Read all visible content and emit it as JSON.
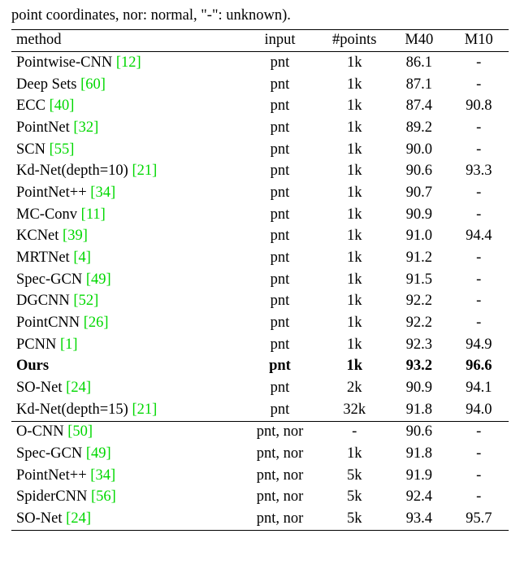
{
  "caption": "point coordinates, nor: normal, \"-\": unknown).",
  "headers": {
    "method": "method",
    "input": "input",
    "points": "#points",
    "m40": "M40",
    "m10": "M10"
  },
  "rows": [
    {
      "name": "Pointwise-CNN ",
      "cite": "[12]",
      "input": "pnt",
      "points": "1k",
      "m40": "86.1",
      "m10": "-",
      "group": 0
    },
    {
      "name": "Deep Sets ",
      "cite": "[60]",
      "input": "pnt",
      "points": "1k",
      "m40": "87.1",
      "m10": "-",
      "group": 0
    },
    {
      "name": "ECC ",
      "cite": "[40]",
      "input": "pnt",
      "points": "1k",
      "m40": "87.4",
      "m10": "90.8",
      "group": 0
    },
    {
      "name": "PointNet ",
      "cite": "[32]",
      "input": "pnt",
      "points": "1k",
      "m40": "89.2",
      "m10": "-",
      "group": 0
    },
    {
      "name": "SCN ",
      "cite": "[55]",
      "input": "pnt",
      "points": "1k",
      "m40": "90.0",
      "m10": "-",
      "group": 0
    },
    {
      "name": "Kd-Net(depth=10) ",
      "cite": "[21]",
      "input": "pnt",
      "points": "1k",
      "m40": "90.6",
      "m10": "93.3",
      "group": 0
    },
    {
      "name": "PointNet++ ",
      "cite": "[34]",
      "input": "pnt",
      "points": "1k",
      "m40": "90.7",
      "m10": "-",
      "group": 0
    },
    {
      "name": "MC-Conv ",
      "cite": "[11]",
      "input": "pnt",
      "points": "1k",
      "m40": "90.9",
      "m10": "-",
      "group": 0
    },
    {
      "name": "KCNet ",
      "cite": "[39]",
      "input": "pnt",
      "points": "1k",
      "m40": "91.0",
      "m10": "94.4",
      "group": 0
    },
    {
      "name": "MRTNet ",
      "cite": "[4]",
      "input": "pnt",
      "points": "1k",
      "m40": "91.2",
      "m10": "-",
      "group": 0
    },
    {
      "name": "Spec-GCN ",
      "cite": "[49]",
      "input": "pnt",
      "points": "1k",
      "m40": "91.5",
      "m10": "-",
      "group": 0
    },
    {
      "name": "DGCNN ",
      "cite": "[52]",
      "input": "pnt",
      "points": "1k",
      "m40": "92.2",
      "m10": "-",
      "group": 0
    },
    {
      "name": "PointCNN ",
      "cite": "[26]",
      "input": "pnt",
      "points": "1k",
      "m40": "92.2",
      "m10": "-",
      "group": 0
    },
    {
      "name": "PCNN ",
      "cite": "[1]",
      "input": "pnt",
      "points": "1k",
      "m40": "92.3",
      "m10": "94.9",
      "group": 0
    },
    {
      "name": "Ours",
      "cite": "",
      "input": "pnt",
      "points": "1k",
      "m40": "93.2",
      "m10": "96.6",
      "group": 0,
      "bold": true
    },
    {
      "name": "SO-Net ",
      "cite": "[24]",
      "input": "pnt",
      "points": "2k",
      "m40": "90.9",
      "m10": "94.1",
      "group": 0
    },
    {
      "name": "Kd-Net(depth=15) ",
      "cite": "[21]",
      "input": "pnt",
      "points": "32k",
      "m40": "91.8",
      "m10": "94.0",
      "group": 0
    },
    {
      "name": "O-CNN ",
      "cite": "[50]",
      "input": "pnt, nor",
      "points": "-",
      "m40": "90.6",
      "m10": "-",
      "group": 1
    },
    {
      "name": "Spec-GCN ",
      "cite": "[49]",
      "input": "pnt, nor",
      "points": "1k",
      "m40": "91.8",
      "m10": "-",
      "group": 1
    },
    {
      "name": "PointNet++ ",
      "cite": "[34]",
      "input": "pnt, nor",
      "points": "5k",
      "m40": "91.9",
      "m10": "-",
      "group": 1
    },
    {
      "name": "SpiderCNN ",
      "cite": "[56]",
      "input": "pnt, nor",
      "points": "5k",
      "m40": "92.4",
      "m10": "-",
      "group": 1
    },
    {
      "name": "SO-Net ",
      "cite": "[24]",
      "input": "pnt, nor",
      "points": "5k",
      "m40": "93.4",
      "m10": "95.7",
      "group": 1
    }
  ]
}
